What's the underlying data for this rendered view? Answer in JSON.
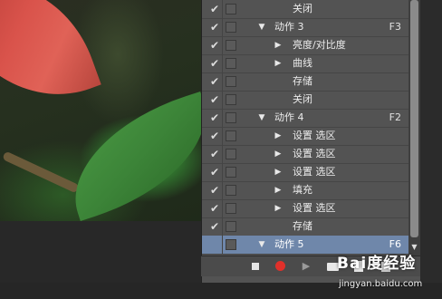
{
  "actions_panel": {
    "rows": [
      {
        "checked": true,
        "indent": 2,
        "expander": "",
        "label": "关闭",
        "key": ""
      },
      {
        "checked": true,
        "indent": 1,
        "expander": "▼",
        "label": "动作 3",
        "key": "F3"
      },
      {
        "checked": true,
        "indent": 2,
        "expander": "▶",
        "label": "亮度/对比度",
        "key": ""
      },
      {
        "checked": true,
        "indent": 2,
        "expander": "▶",
        "label": "曲线",
        "key": ""
      },
      {
        "checked": true,
        "indent": 2,
        "expander": "",
        "label": "存储",
        "key": ""
      },
      {
        "checked": true,
        "indent": 2,
        "expander": "",
        "label": "关闭",
        "key": ""
      },
      {
        "checked": true,
        "indent": 1,
        "expander": "▼",
        "label": "动作 4",
        "key": "F2"
      },
      {
        "checked": true,
        "indent": 2,
        "expander": "▶",
        "label": "设置 选区",
        "key": ""
      },
      {
        "checked": true,
        "indent": 2,
        "expander": "▶",
        "label": "设置 选区",
        "key": ""
      },
      {
        "checked": true,
        "indent": 2,
        "expander": "▶",
        "label": "设置 选区",
        "key": ""
      },
      {
        "checked": true,
        "indent": 2,
        "expander": "▶",
        "label": "填充",
        "key": ""
      },
      {
        "checked": true,
        "indent": 2,
        "expander": "▶",
        "label": "设置 选区",
        "key": ""
      },
      {
        "checked": true,
        "indent": 2,
        "expander": "",
        "label": "存储",
        "key": ""
      },
      {
        "checked": false,
        "indent": 1,
        "expander": "▼",
        "label": "动作 5",
        "key": "F6",
        "selected": true
      }
    ],
    "check_glyph": "✔",
    "scroll_down_glyph": "▼"
  },
  "toolbar": {
    "buttons": [
      "stop-icon",
      "record-icon",
      "play-icon",
      "new-set-icon",
      "new-action-icon",
      "delete-icon"
    ],
    "play_glyph": "▶"
  },
  "colors": {
    "panel_bg": "#535353",
    "selected_row": "#6f87aa",
    "record_red": "#e0302a"
  },
  "watermark": {
    "logo_text": "Bai度经验",
    "url": "jingyan.baidu.com"
  }
}
